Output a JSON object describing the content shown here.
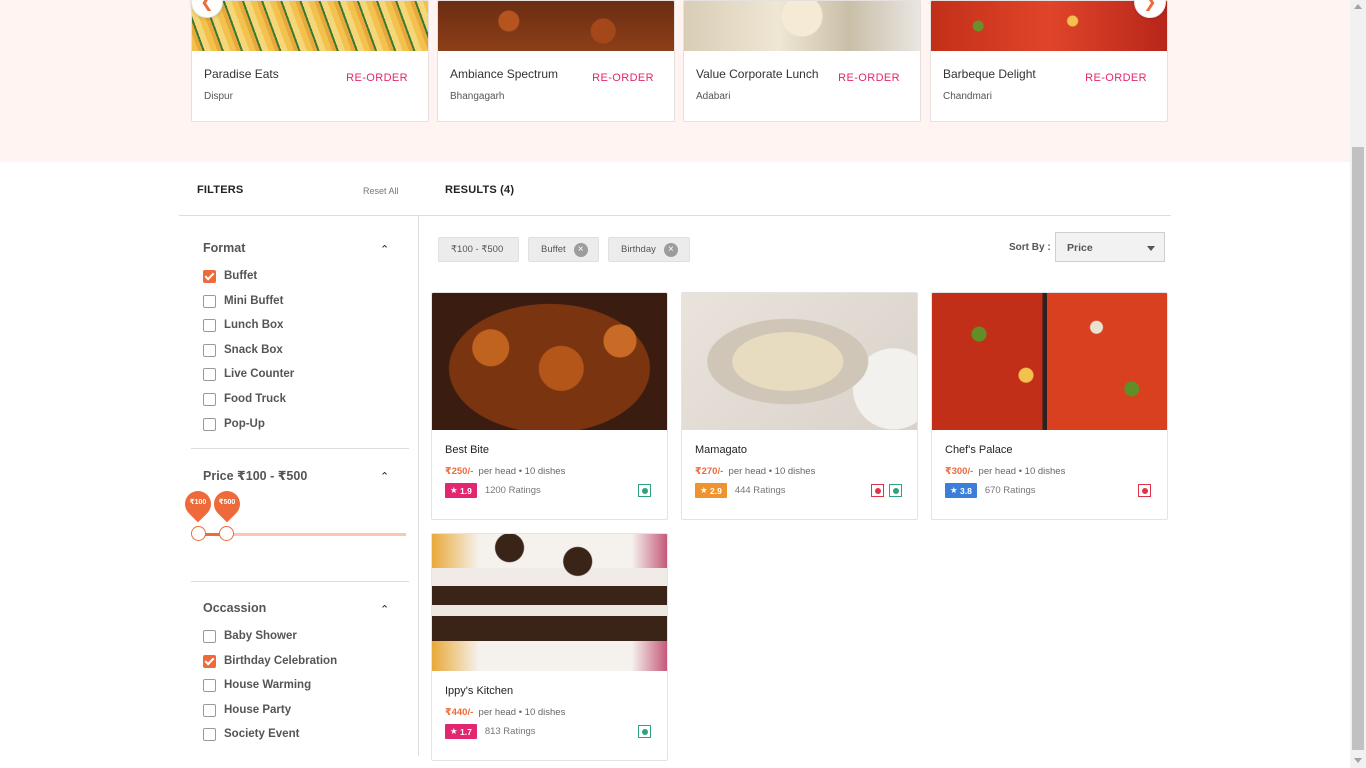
{
  "reorder": {
    "action_label": "RE-ORDER",
    "items": [
      {
        "name": "Paradise Eats",
        "location": "Dispur"
      },
      {
        "name": "Ambiance Spectrum",
        "location": "Bhangagarh"
      },
      {
        "name": "Value Corporate Lunch",
        "location": "Adabari"
      },
      {
        "name": "Barbeque Delight",
        "location": "Chandmari"
      }
    ]
  },
  "filters": {
    "title": "FILTERS",
    "reset_label": "Reset All",
    "format": {
      "title": "Format",
      "options": [
        {
          "label": "Buffet",
          "checked": true
        },
        {
          "label": "Mini Buffet",
          "checked": false
        },
        {
          "label": "Lunch Box",
          "checked": false
        },
        {
          "label": "Snack Box",
          "checked": false
        },
        {
          "label": "Live Counter",
          "checked": false
        },
        {
          "label": "Food Truck",
          "checked": false
        },
        {
          "label": "Pop-Up",
          "checked": false
        }
      ]
    },
    "price": {
      "title": "Price ₹100 - ₹500",
      "min_label": "₹100",
      "max_label": "₹500"
    },
    "occasion": {
      "title": "Occassion",
      "options": [
        {
          "label": "Baby Shower",
          "checked": false
        },
        {
          "label": "Birthday Celebration",
          "checked": true
        },
        {
          "label": "House Warming",
          "checked": false
        },
        {
          "label": "House Party",
          "checked": false
        },
        {
          "label": "Society Event",
          "checked": false
        }
      ]
    }
  },
  "results": {
    "title": "RESULTS (4)",
    "chips": [
      {
        "label": "₹100 - ₹500",
        "removable": false
      },
      {
        "label": "Buffet",
        "removable": true
      },
      {
        "label": "Birthday",
        "removable": true
      }
    ],
    "sort_label": "Sort By :",
    "sort_value": "Price",
    "per_head": "per head",
    "cards": [
      {
        "name": "Best Bite",
        "price": "₹250/-",
        "dishes": "10 dishes",
        "rating": "1.9",
        "ratings_count": "1200 Ratings",
        "rating_color": "#e2266f"
      },
      {
        "name": "Mamagato",
        "price": "₹270/-",
        "dishes": "10 dishes",
        "rating": "2.9",
        "ratings_count": "444 Ratings",
        "rating_color": "#f0922d"
      },
      {
        "name": "Chef's Palace",
        "price": "₹300/-",
        "dishes": "10 dishes",
        "rating": "3.8",
        "ratings_count": "670 Ratings",
        "rating_color": "#3b7fd8"
      },
      {
        "name": "Ippy's Kitchen",
        "price": "₹440/-",
        "dishes": "10 dishes",
        "rating": "1.7",
        "ratings_count": "813 Ratings",
        "rating_color": "#e2266f"
      }
    ]
  },
  "colors": {
    "accent": "#ee6a3a",
    "reorder": "#e2266f",
    "veg": "#2fa37b",
    "nonveg": "#e0334a"
  }
}
